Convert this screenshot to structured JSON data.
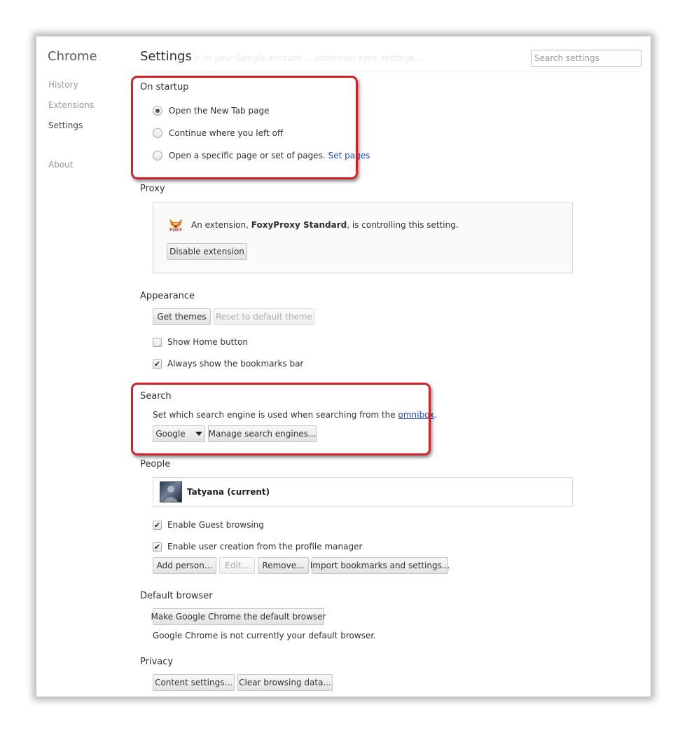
{
  "sidebar": {
    "brand": "Chrome",
    "items": [
      {
        "label": "History"
      },
      {
        "label": "Extensions"
      },
      {
        "label": "Settings"
      },
      {
        "label": "About"
      }
    ]
  },
  "header": {
    "title": "Settings",
    "ghost_text": "...n to your Google account ... extension sync settings...",
    "search_placeholder": "Search settings"
  },
  "startup": {
    "title": "On startup",
    "options": [
      {
        "label": "Open the New Tab page",
        "selected": true
      },
      {
        "label": "Continue where you left off",
        "selected": false
      },
      {
        "label": "Open a specific page or set of pages.",
        "selected": false
      }
    ],
    "set_pages_link": "Set pages"
  },
  "proxy": {
    "title": "Proxy",
    "icon_label": "FOXY",
    "text_before": "An extension,",
    "extension_name": "FoxyProxy Standard",
    "text_after": ", is controlling this setting.",
    "disable_button": "Disable extension"
  },
  "appearance": {
    "title": "Appearance",
    "get_themes": "Get themes",
    "reset_theme": "Reset to default theme",
    "show_home": {
      "label": "Show Home button",
      "checked": false
    },
    "bookmarks_bar": {
      "label": "Always show the bookmarks bar",
      "checked": true
    }
  },
  "search": {
    "title": "Search",
    "desc_before": "Set which search engine is used when searching from the",
    "omnibox_link": "omnibox",
    "desc_after": ".",
    "engine_selected": "Google",
    "manage_button": "Manage search engines..."
  },
  "people": {
    "title": "People",
    "profile_name": "Tatyana (current)",
    "guest": {
      "label": "Enable Guest browsing",
      "checked": true
    },
    "user_creation": {
      "label": "Enable user creation from the profile manager",
      "checked": true
    },
    "buttons": {
      "add": "Add person...",
      "edit": "Edit...",
      "remove": "Remove...",
      "import": "Import bookmarks and settings..."
    }
  },
  "default_browser": {
    "title": "Default browser",
    "button": "Make Google Chrome the default browser",
    "status": "Google Chrome is not currently your default browser."
  },
  "privacy": {
    "title": "Privacy",
    "content_settings": "Content settings...",
    "clear_data": "Clear browsing data..."
  },
  "colors": {
    "highlight": "#d4202a",
    "link": "#1a49c2"
  }
}
